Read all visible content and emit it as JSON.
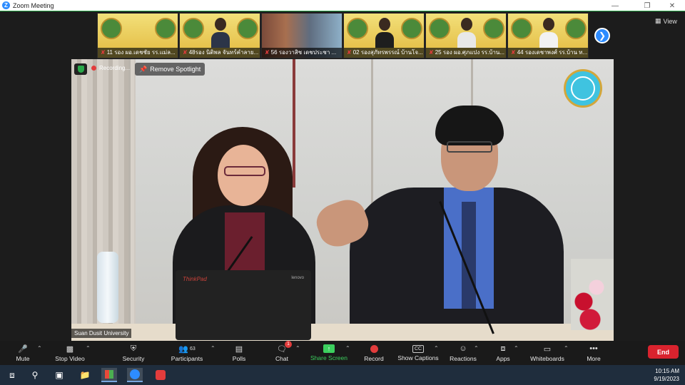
{
  "window": {
    "title": "Zoom Meeting",
    "controls": [
      "minimize",
      "restore",
      "close"
    ]
  },
  "top": {
    "view_label": "View",
    "thumbnails": [
      {
        "name": "11 รอง ผอ.เดชชัย รร.แม่ล..."
      },
      {
        "name": "48รอง นิติพล จันทร์คำลาย..."
      },
      {
        "name": "56 รองวาสิช เดชประชา ..."
      },
      {
        "name": "02 รองสุภัทรพรรณ์ บ้านโจ..."
      },
      {
        "name": "25 รอง ผอ.ศุภแปง รร.บ้าน..."
      },
      {
        "name": "44 รองเดชาพงศ์ รร.บ้าน ท..."
      }
    ]
  },
  "main": {
    "recording_label": "Recording...",
    "remove_spotlight_label": "Remove Spotlight",
    "speaker_name": "Suan Dusit University",
    "laptop_brand_left": "ThinkPad",
    "laptop_brand_right": "lenovo"
  },
  "toolbar": {
    "items": [
      {
        "label": "Mute",
        "icon": "microphone-icon"
      },
      {
        "label": "Stop Video",
        "icon": "video-camera-icon"
      },
      {
        "label": "Security",
        "icon": "shield-icon"
      },
      {
        "label": "Participants",
        "icon": "people-icon",
        "count": "63"
      },
      {
        "label": "Polls",
        "icon": "bar-chart-icon"
      },
      {
        "label": "Chat",
        "icon": "chat-bubble-icon",
        "badge": "1"
      },
      {
        "label": "Share Screen",
        "icon": "share-arrow-icon"
      },
      {
        "label": "Record",
        "icon": "record-icon"
      },
      {
        "label": "Show Captions",
        "icon": "cc-icon"
      },
      {
        "label": "Reactions",
        "icon": "smiley-icon"
      },
      {
        "label": "Apps",
        "icon": "apps-icon"
      },
      {
        "label": "Whiteboards",
        "icon": "whiteboard-icon"
      },
      {
        "label": "More",
        "icon": "more-dots-icon"
      }
    ],
    "end_label": "End",
    "share_color": "#3ccf5e",
    "end_color": "#d9232e"
  },
  "taskbar": {
    "time": "10:15 AM",
    "date": "9/19/2023"
  }
}
